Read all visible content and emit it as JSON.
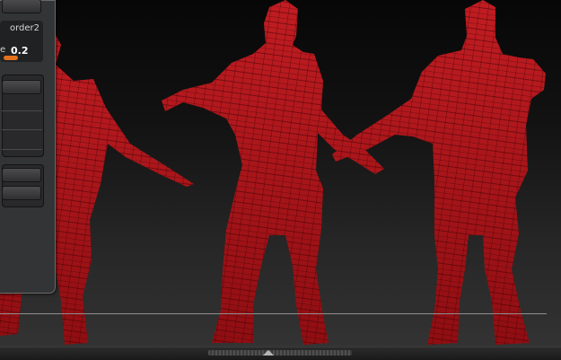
{
  "palette": {
    "slider_title": "order2",
    "slider_label": "e",
    "slider_value": "0.2",
    "slider_level": 0.2,
    "accent_color": "#e2711d"
  },
  "viewport": {
    "model_color": "#b5161b",
    "wire_color": "#3a0003",
    "icons": [
      "3d-model-wireframe-view"
    ]
  },
  "tray": {
    "arrows": "◢◣"
  }
}
